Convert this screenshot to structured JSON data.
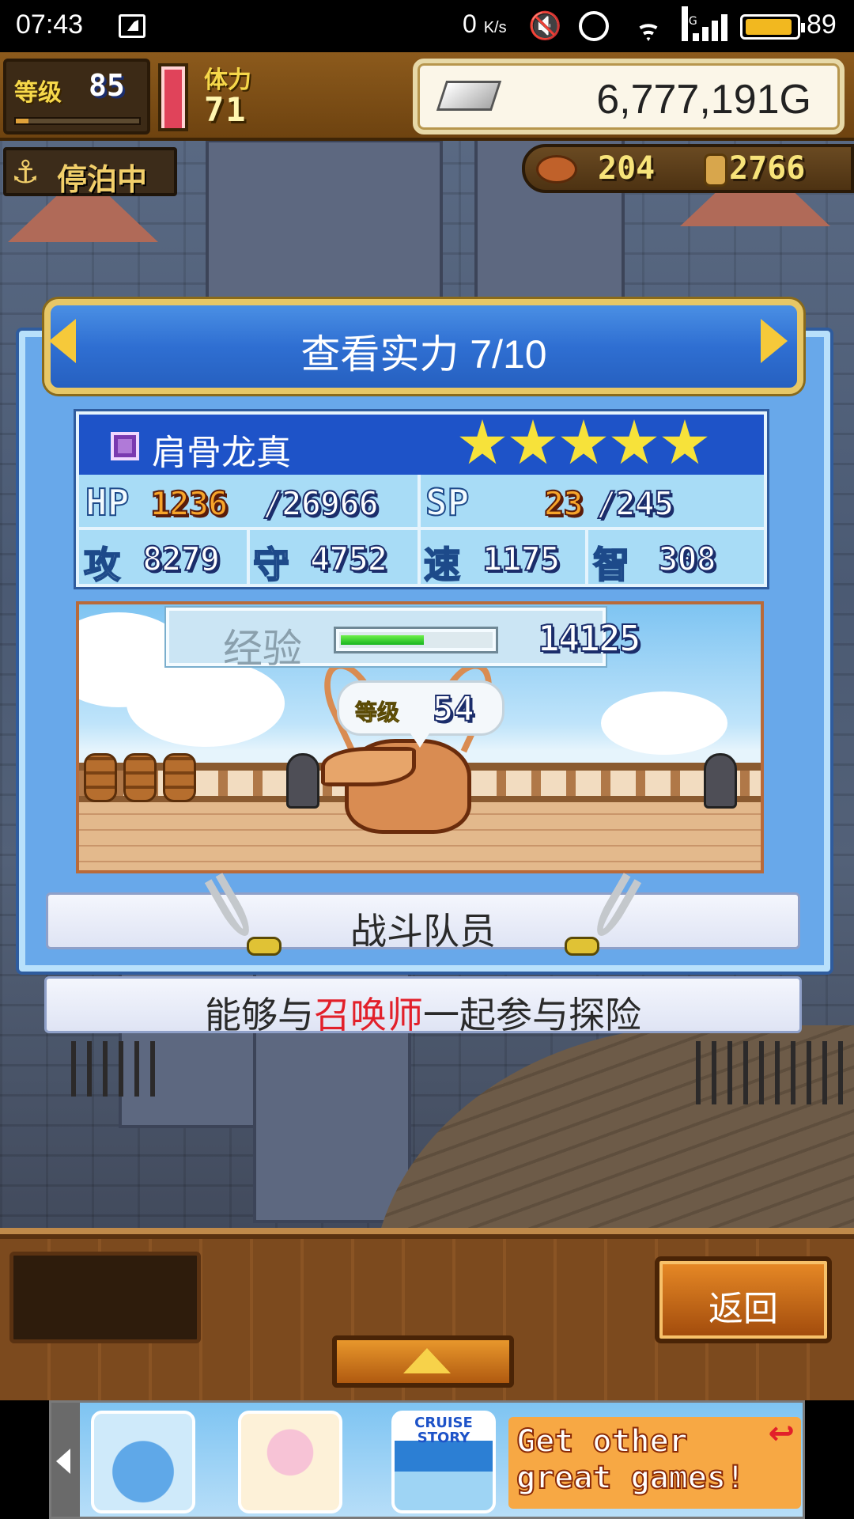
{
  "status_bar": {
    "time": "07:43",
    "net_speed": "0",
    "net_unit": "K/s",
    "cell_tag": "4G",
    "battery_pct": "89",
    "battery_level": 0.89
  },
  "hud": {
    "level_label": "等级",
    "level_value": "85",
    "level_progress": 0.1,
    "stamina_label": "体力",
    "stamina_value": "71",
    "stamina_fill": 0.95,
    "gold_value": "6,777,191G",
    "moor_icon": "anchor-icon",
    "moor_label": "停泊中",
    "food_value": "204",
    "wood_value": "2766"
  },
  "dialog": {
    "title": "查看实力 7/10",
    "prev_icon": "arrow-left-icon",
    "next_icon": "arrow-right-icon",
    "unit": {
      "name": "肩骨龙真",
      "rank_icon": "purple-rank-badge-icon",
      "stars": 5,
      "hp_label": "HP",
      "hp_current": "1236",
      "hp_max": "/26966",
      "sp_label": "SP",
      "sp_current": "23",
      "sp_max": "/245",
      "atk_label": "攻",
      "atk_value": "8279",
      "def_label": "守",
      "def_value": "4752",
      "spd_label": "速",
      "spd_value": "1175",
      "int_label": "智",
      "int_value": "308"
    },
    "exp_label": "经验",
    "exp_value": "14125",
    "exp_progress": 0.55,
    "level_label": "等级",
    "level_value": "54",
    "role_label": "战斗队员",
    "desc_before": "能够与",
    "desc_highlight": "召唤师",
    "desc_after": "一起参与探险",
    "highlight_color": "#e2202a"
  },
  "bottom_menu": {
    "back_label": "返回",
    "up_icon": "triangle-up-icon"
  },
  "ad": {
    "scroll_icon": "arrow-left-icon",
    "game3_caption": "CRUISE STORY",
    "promo_text": "Get other\ngreat games!",
    "return_icon": "return-arrow-icon"
  }
}
